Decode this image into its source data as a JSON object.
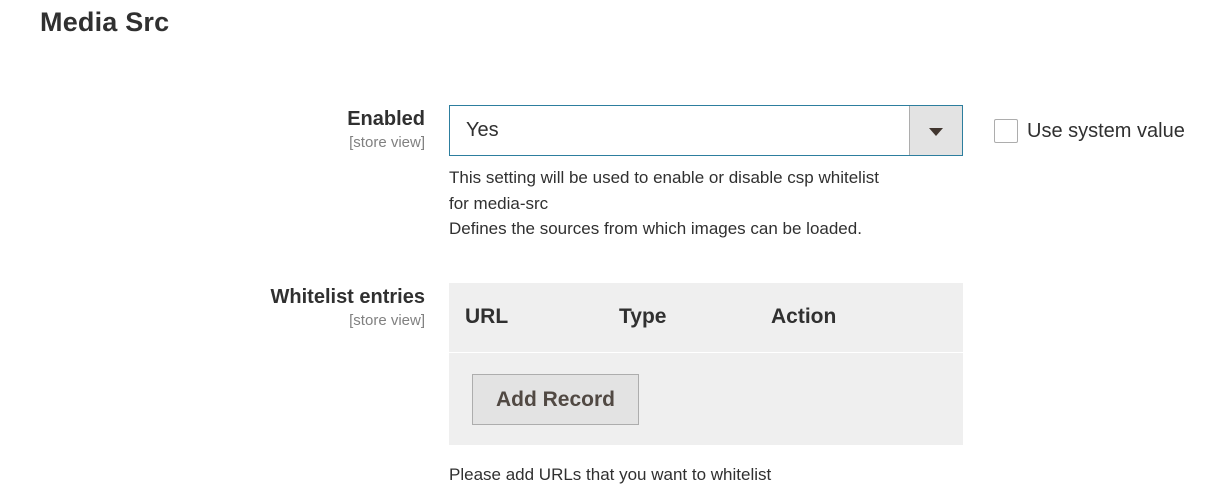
{
  "section": {
    "title": "Media Src"
  },
  "enabled_field": {
    "label": "Enabled",
    "scope": "[store view]",
    "selected_value": "Yes",
    "use_system_value_label": "Use system value",
    "use_system_value_checked": false,
    "note_lines": [
      "This setting will be used to enable or disable csp whitelist",
      "for media-src",
      "Defines the sources from which images can be loaded."
    ]
  },
  "whitelist_field": {
    "label": "Whitelist entries",
    "scope": "[store view]",
    "columns": [
      "URL",
      "Type",
      "Action"
    ],
    "add_button_label": "Add Record",
    "note": "Please add URLs that you want to whitelist"
  },
  "icons": {
    "select_arrow": "caret-down-icon",
    "checkbox": "checkbox-unchecked-icon"
  },
  "colors": {
    "select_border": "#2d7e9e",
    "table_background": "#efefef",
    "button_background": "#e3e3e3",
    "label_scope": "#808080",
    "text": "#303030"
  }
}
